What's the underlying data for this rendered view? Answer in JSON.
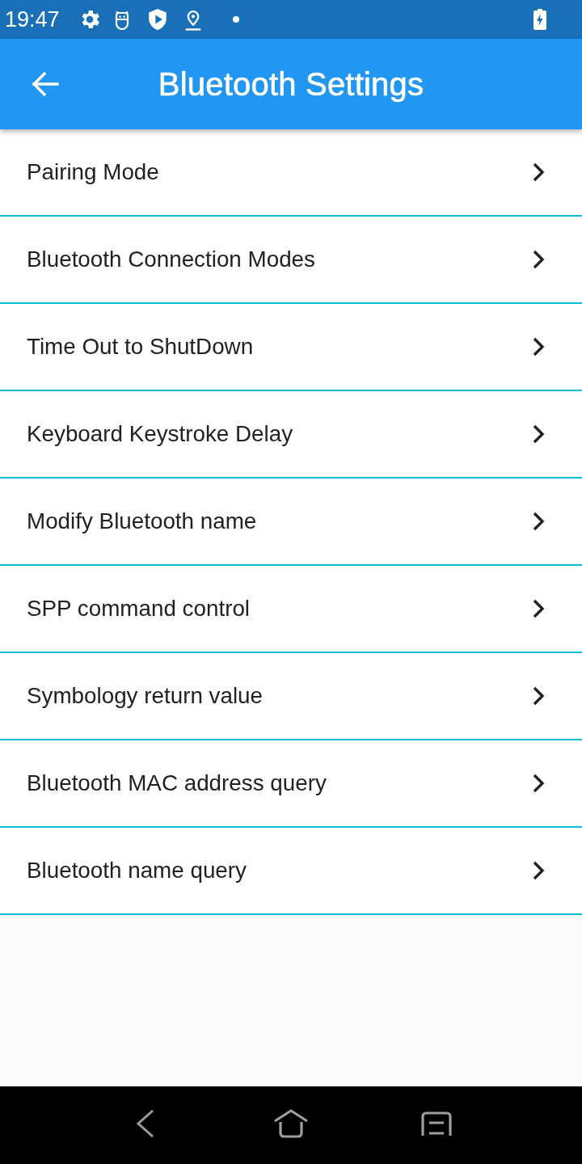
{
  "status_bar": {
    "time": "19:47"
  },
  "app_bar": {
    "title": "Bluetooth Settings"
  },
  "menu_items": [
    {
      "label": "Pairing Mode"
    },
    {
      "label": "Bluetooth Connection Modes"
    },
    {
      "label": "Time Out to ShutDown"
    },
    {
      "label": "Keyboard Keystroke Delay"
    },
    {
      "label": "Modify Bluetooth name"
    },
    {
      "label": "SPP command control"
    },
    {
      "label": "Symbology return value"
    },
    {
      "label": "Bluetooth MAC address query"
    },
    {
      "label": "Bluetooth name query"
    }
  ]
}
